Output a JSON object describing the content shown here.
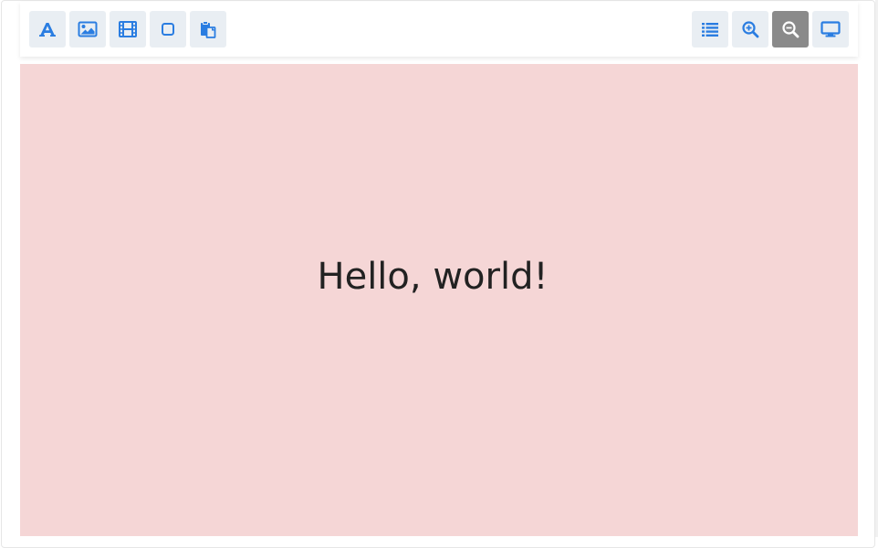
{
  "toolbar": {
    "left_tools": [
      {
        "name": "text-tool",
        "icon": "font-icon"
      },
      {
        "name": "image-tool",
        "icon": "image-icon"
      },
      {
        "name": "video-tool",
        "icon": "film-icon"
      },
      {
        "name": "shape-tool",
        "icon": "square-icon"
      },
      {
        "name": "paste-tool",
        "icon": "paste-icon"
      }
    ],
    "right_tools": [
      {
        "name": "list-view",
        "icon": "list-icon"
      },
      {
        "name": "zoom-in",
        "icon": "zoom-in-icon"
      },
      {
        "name": "zoom-out",
        "icon": "zoom-out-icon",
        "active": true
      },
      {
        "name": "preview",
        "icon": "monitor-icon"
      }
    ]
  },
  "canvas": {
    "background": "#f5d6d6",
    "text": "Hello, world!"
  },
  "colors": {
    "icon": "#2a7de1",
    "button_bg": "#e9eef3",
    "active_bg": "#8a8a8a",
    "active_icon": "#ffffff"
  }
}
